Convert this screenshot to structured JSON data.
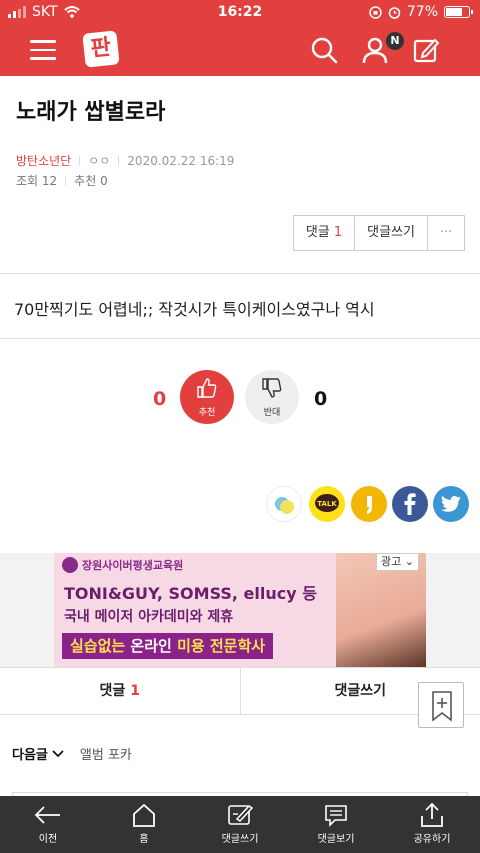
{
  "status": {
    "carrier": "SKT",
    "time": "16:22",
    "battery": "77%",
    "battery_level": 0.77
  },
  "header": {
    "logo": "판",
    "notification_badge": "N"
  },
  "post": {
    "title": "노래가 쌉별로라",
    "author": "방탄소년단",
    "nick": "ㅇㅇ",
    "date": "2020.02.22 16:19",
    "views_label": "조회 12",
    "recommend_label": "추천 0",
    "body": "70만찍기도 어렵네;; 작것시가 특이케이스였구나 역시"
  },
  "comment_buttons": {
    "comments_label": "댓글",
    "comments_count": "1",
    "write_label": "댓글쓰기",
    "more": "···"
  },
  "votes": {
    "up_count": "0",
    "up_label": "추천",
    "down_count": "0",
    "down_label": "반대"
  },
  "share_colors": {
    "kakaotalk": "#ffe11b",
    "story": "#f2b705",
    "facebook": "#3b5998",
    "twitter": "#3b97d3",
    "brand": "#e2403f"
  },
  "share": {
    "talk_label": "TALK"
  },
  "ad": {
    "org": "장원사이버평생교육원",
    "line1": "TONI&GUY, SOMSS, ellucy 등",
    "line2": "국내 메이저 아카데미와 제휴",
    "line3_a": "실습없는",
    "line3_b": " 온라인 ",
    "line3_c": "미용 전문학사",
    "tag": "광고"
  },
  "comment_bar": {
    "comments_label": "댓글",
    "comments_count": "1",
    "write_label": "댓글쓰기"
  },
  "next": {
    "label": "다음글",
    "title": "앨범 포카"
  },
  "bottom_nav": [
    {
      "label": "이전",
      "icon": "back-arrow-icon"
    },
    {
      "label": "홈",
      "icon": "home-icon"
    },
    {
      "label": "댓글쓰기",
      "icon": "write-comment-icon"
    },
    {
      "label": "댓글보기",
      "icon": "view-comments-icon"
    },
    {
      "label": "공유하기",
      "icon": "share-icon"
    }
  ]
}
